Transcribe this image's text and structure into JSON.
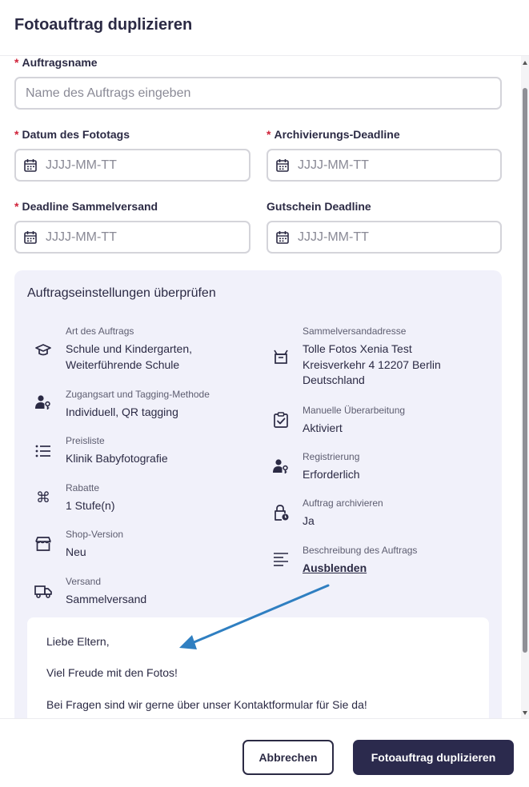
{
  "dialog": {
    "title": "Fotoauftrag duplizieren"
  },
  "form": {
    "required_mark": "*",
    "order_name": {
      "label": "Auftragsname",
      "placeholder": "Name des Auftrags eingeben"
    },
    "photo_date": {
      "label": "Datum des Fototags",
      "placeholder": "JJJJ-MM-TT"
    },
    "archive_deadline": {
      "label": "Archivierungs-Deadline",
      "placeholder": "JJJJ-MM-TT"
    },
    "bulk_deadline": {
      "label": "Deadline Sammelversand",
      "placeholder": "JJJJ-MM-TT"
    },
    "voucher_deadline": {
      "label": "Gutschein Deadline",
      "placeholder": "JJJJ-MM-TT"
    }
  },
  "review": {
    "title": "Auftragseinstellungen überprüfen",
    "left": [
      {
        "icon": "graduation-cap-icon",
        "label": "Art des Auftrags",
        "value": "Schule und Kindergarten,\nWeiterführende Schule"
      },
      {
        "icon": "user-key-icon",
        "label": "Zugangsart und Tagging-Methode",
        "value": "Individuell, QR tagging"
      },
      {
        "icon": "list-icon",
        "label": "Preisliste",
        "value": "Klinik Babyfotografie"
      },
      {
        "icon": "command-icon",
        "label": "Rabatte",
        "value": "1 Stufe(n)"
      },
      {
        "icon": "shop-icon",
        "label": "Shop-Version",
        "value": "Neu"
      },
      {
        "icon": "truck-icon",
        "label": "Versand",
        "value": "Sammelversand"
      }
    ],
    "right": [
      {
        "icon": "package-icon",
        "label": "Sammelversandadresse",
        "value": "Tolle Fotos Xenia Test\nKreisverkehr 4 12207 Berlin\nDeutschland"
      },
      {
        "icon": "clipboard-check-icon",
        "label": "Manuelle Überarbeitung",
        "value": "Aktiviert"
      },
      {
        "icon": "user-key-icon",
        "label": "Registrierung",
        "value": "Erforderlich"
      },
      {
        "icon": "lock-clock-icon",
        "label": "Auftrag archivieren",
        "value": "Ja"
      },
      {
        "icon": "text-align-icon",
        "label": "Beschreibung des Auftrags",
        "link": "Ausblenden"
      }
    ],
    "description": [
      "Liebe Eltern,",
      "Viel Freude mit den Fotos!",
      "Bei Fragen sind wir gerne über unser Kontaktformular für Sie da!"
    ]
  },
  "footer": {
    "cancel_label": "Abbrechen",
    "submit_label": "Fotoauftrag duplizieren"
  },
  "colors": {
    "primary": "#2b2a4d",
    "required": "#d0233a",
    "panel_bg": "#f1f1fa",
    "annotation_arrow": "#2f7fc1"
  }
}
